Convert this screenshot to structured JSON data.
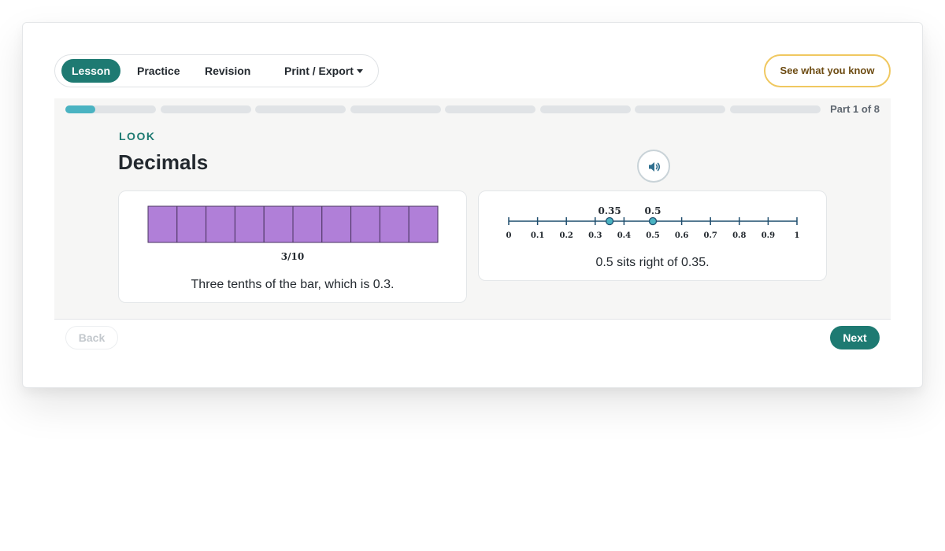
{
  "nav": {
    "tabs": [
      {
        "label": "Lesson",
        "active": true
      },
      {
        "label": "Practice",
        "active": false
      },
      {
        "label": "Revision",
        "active": false
      },
      {
        "label": "Print / Export",
        "active": false
      }
    ],
    "know_button": "See what you know"
  },
  "progress": {
    "part_label": "Part 1 of 8",
    "total_parts": 8,
    "current_part": 1,
    "current_fill": 0.33
  },
  "lesson": {
    "kicker": "LOOK",
    "title": "Decimals",
    "audio_icon": "speaker-icon"
  },
  "fraction_bar": {
    "parts": 10,
    "label": "3/10",
    "caption": "Three tenths of the bar, which is 0.3."
  },
  "number_line": {
    "min": 0,
    "max": 1,
    "ticks": [
      "0",
      "0.1",
      "0.2",
      "0.3",
      "0.4",
      "0.5",
      "0.6",
      "0.7",
      "0.8",
      "0.9",
      "1"
    ],
    "points": [
      {
        "value": 0.35,
        "label": "0.35"
      },
      {
        "value": 0.5,
        "label": "0.5"
      }
    ],
    "caption": "0.5 sits right of 0.35."
  },
  "footer": {
    "back_label": "Back",
    "next_label": "Next"
  },
  "colors": {
    "accent": "#1e7a72",
    "progress": "#4ab3c2",
    "bar_fill": "#b07fd8",
    "line": "#1f4e6e",
    "know_border": "#f0c860"
  }
}
